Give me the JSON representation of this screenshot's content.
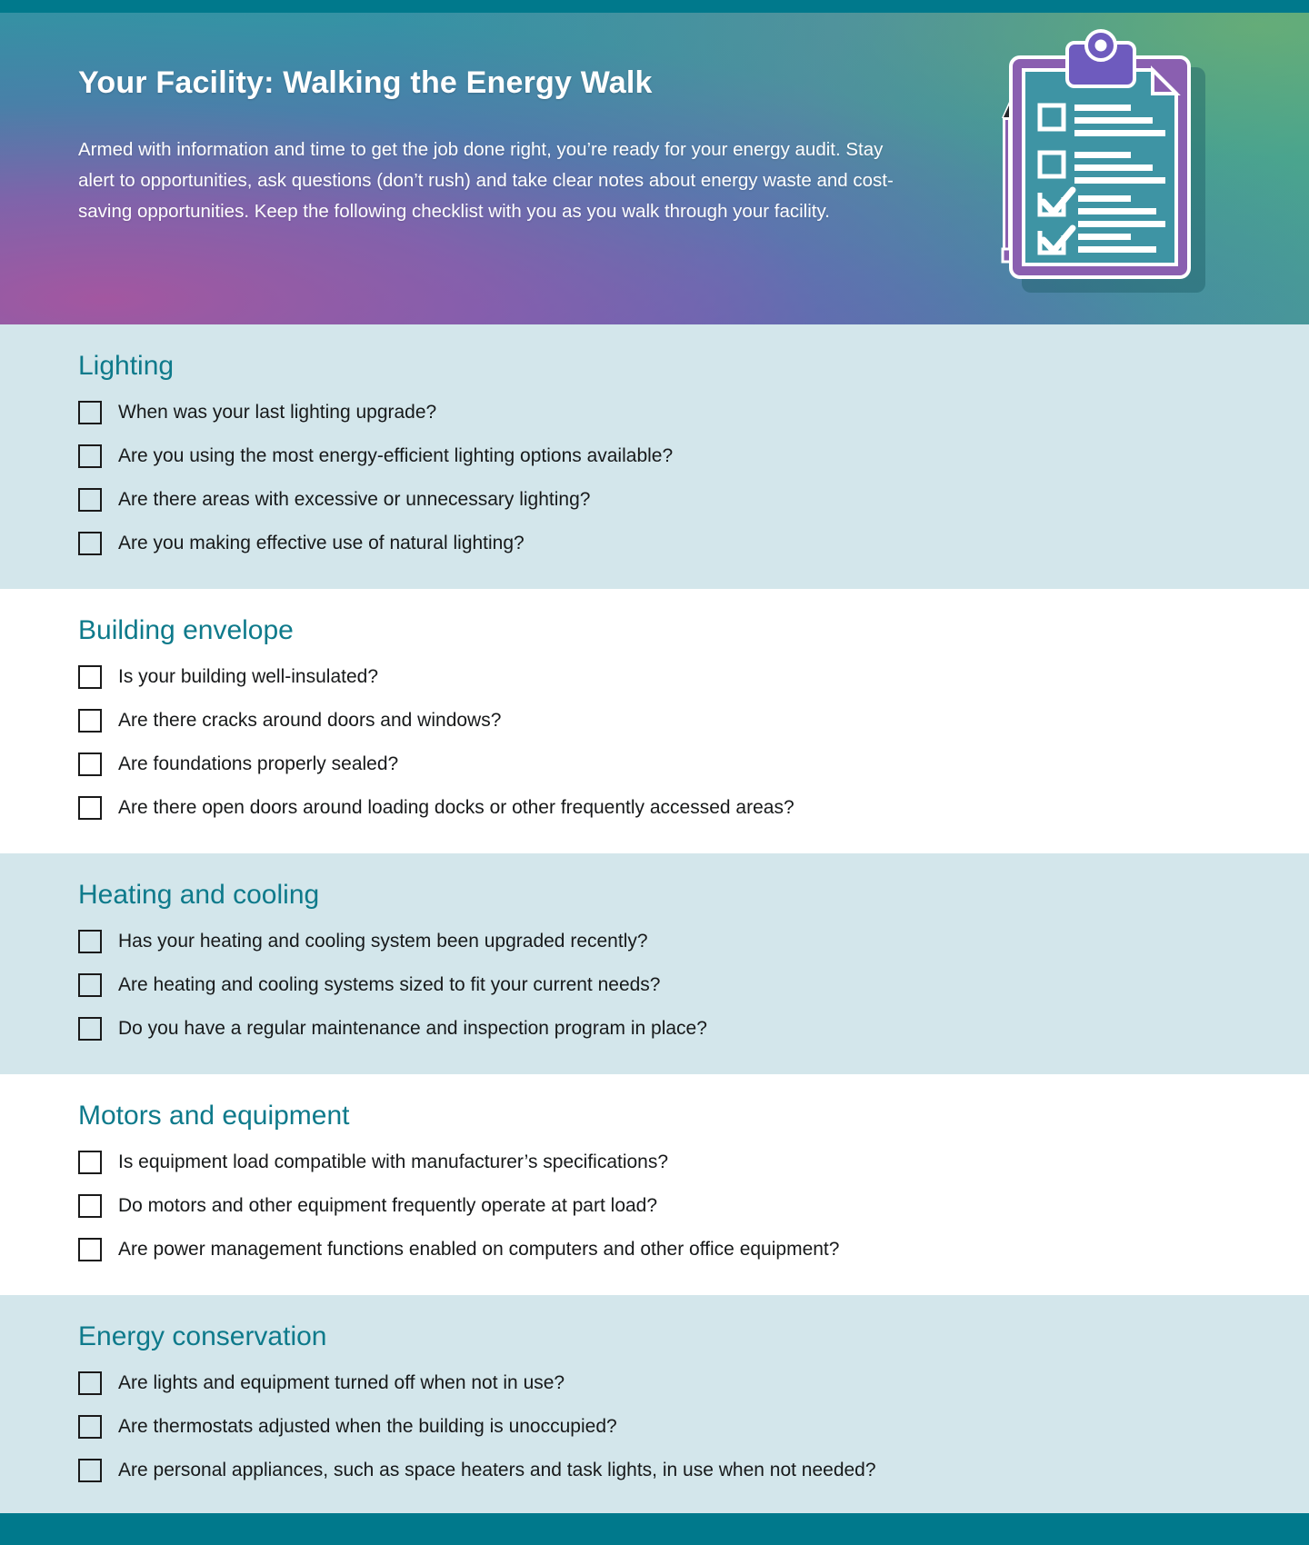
{
  "colors": {
    "accent_teal": "#00798C",
    "heading_teal": "#0E7A8B",
    "band_tint": "#D3E6EB",
    "band_plain": "#FFFFFF",
    "clipboard_purple": "#8A5FB0",
    "clipboard_body": "#3E94A4",
    "text_dark": "#17191A",
    "header_text": "#FFFFFF"
  },
  "header": {
    "title": "Your Facility: Walking the Energy Walk",
    "body": "Armed with information and time to get the job done right, you’re ready for your energy audit. Stay alert to opportunities, ask questions (don’t rush) and take clear notes about energy waste and cost-saving opportunities. Keep the following checklist with you as you walk through your facility.",
    "illustration": "clipboard-with-pencil-icon"
  },
  "sections": [
    {
      "id": "lighting",
      "title": "Lighting",
      "tinted": true,
      "items": [
        "When was your last lighting upgrade?",
        "Are you using the most energy-efficient lighting options available?",
        "Are there areas with excessive or unnecessary lighting?",
        "Are you making effective use of natural lighting?"
      ]
    },
    {
      "id": "building-envelope",
      "title": "Building envelope",
      "tinted": false,
      "items": [
        "Is your building well-insulated?",
        "Are there cracks around doors and windows?",
        "Are foundations properly sealed?",
        "Are there open doors around loading docks or other frequently accessed areas?"
      ]
    },
    {
      "id": "heating-and-cooling",
      "title": "Heating and cooling",
      "tinted": true,
      "items": [
        "Has your heating and cooling system been upgraded recently?",
        "Are heating and cooling systems sized to fit your current needs?",
        "Do you have a regular maintenance and inspection program in place?"
      ]
    },
    {
      "id": "motors-and-equipment",
      "title": "Motors and equipment",
      "tinted": false,
      "items": [
        "Is equipment load compatible with manufacturer’s specifications?",
        "Do motors and other equipment frequently operate at part load?",
        "Are power management functions enabled on computers and other office equipment?"
      ]
    },
    {
      "id": "energy-conservation",
      "title": "Energy conservation",
      "tinted": true,
      "items": [
        "Are lights and equipment turned off when not in use?",
        "Are thermostats adjusted when the building is unoccupied?",
        "Are personal appliances, such as space heaters and task lights, in use when not needed?"
      ]
    }
  ]
}
